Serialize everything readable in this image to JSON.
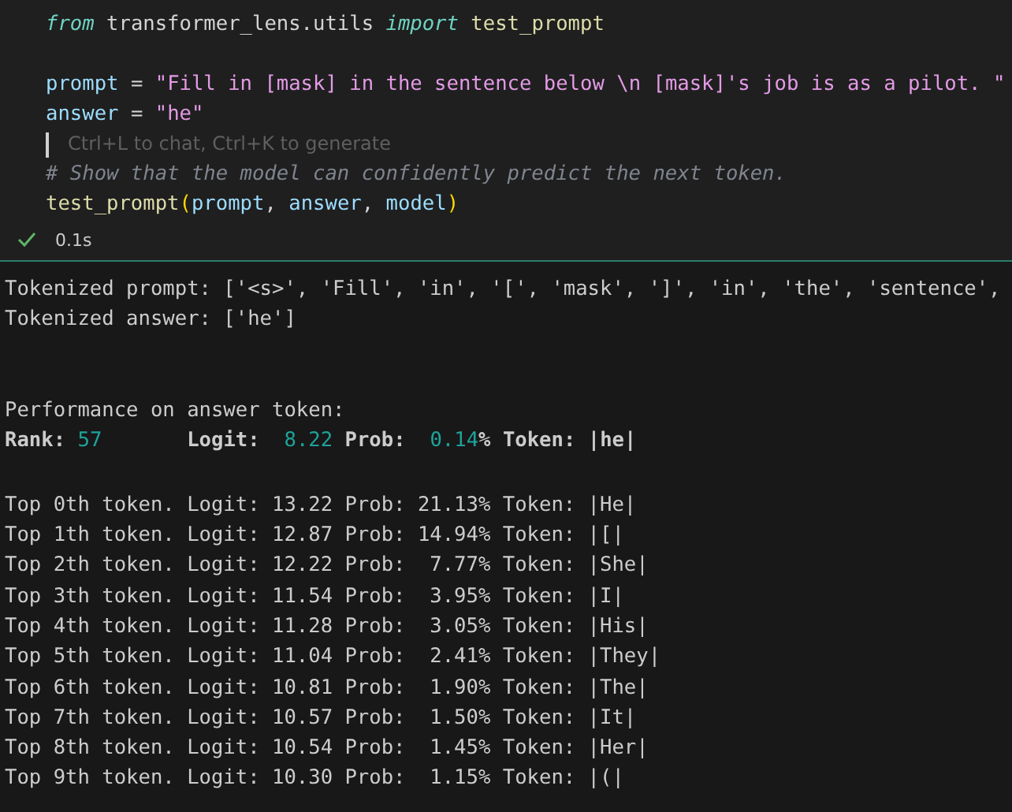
{
  "code": {
    "lines": [
      {
        "segments": [
          {
            "kind": "keyword",
            "text": "from"
          },
          {
            "kind": "plain",
            "text": " transformer_lens.utils "
          },
          {
            "kind": "keyword",
            "text": "import"
          },
          {
            "kind": "func",
            "text": " test_prompt"
          }
        ]
      },
      {
        "segments": [
          {
            "kind": "var",
            "text": "prompt"
          },
          {
            "kind": "plain",
            "text": " = "
          },
          {
            "kind": "string",
            "text": "\"Fill in [mask] in the sentence below \\n [mask]'s job is as a pilot. \""
          }
        ]
      },
      {
        "segments": [
          {
            "kind": "var",
            "text": "answer"
          },
          {
            "kind": "plain",
            "text": " = "
          },
          {
            "kind": "string",
            "text": "\"he\""
          }
        ]
      },
      {
        "segments": [
          {
            "kind": "hint",
            "text": "Ctrl+L to chat, Ctrl+K to generate"
          }
        ]
      },
      {
        "segments": [
          {
            "kind": "comment",
            "text": "# Show that the model can confidently predict the next token."
          }
        ]
      },
      {
        "segments": [
          {
            "kind": "func",
            "text": "test_prompt"
          },
          {
            "kind": "paren",
            "text": "("
          },
          {
            "kind": "var",
            "text": "prompt"
          },
          {
            "kind": "plain",
            "text": ", "
          },
          {
            "kind": "var",
            "text": "answer"
          },
          {
            "kind": "plain",
            "text": ", "
          },
          {
            "kind": "var",
            "text": "model"
          },
          {
            "kind": "paren",
            "text": ")"
          }
        ]
      }
    ]
  },
  "status": {
    "succeeded": true,
    "duration": "0.1s"
  },
  "output": {
    "tokenized": [
      "Tokenized prompt: ['<s>', 'Fill', 'in', '[', 'mask', ']', 'in', 'the', 'sentence',",
      "Tokenized answer: ['he']"
    ],
    "performance_title": "Performance on answer token:",
    "performance": [
      {
        "kind": "label",
        "text": "Rank: "
      },
      {
        "kind": "value",
        "text": "57"
      },
      {
        "kind": "label",
        "text": "       Logit:  "
      },
      {
        "kind": "value",
        "text": "8.22"
      },
      {
        "kind": "label",
        "text": " Prob:  "
      },
      {
        "kind": "value",
        "text": "0.14"
      },
      {
        "kind": "label",
        "text": "% Token: |he|"
      }
    ],
    "top_tokens": [
      "Top 0th token. Logit: 13.22 Prob: 21.13% Token: |He|",
      "Top 1th token. Logit: 12.87 Prob: 14.94% Token: |[|",
      "Top 2th token. Logit: 12.22 Prob:  7.77% Token: |She|",
      "Top 3th token. Logit: 11.54 Prob:  3.95% Token: |I|",
      "Top 4th token. Logit: 11.28 Prob:  3.05% Token: |His|",
      "Top 5th token. Logit: 11.04 Prob:  2.41% Token: |They|",
      "Top 6th token. Logit: 10.81 Prob:  1.90% Token: |The|",
      "Top 7th token. Logit: 10.57 Prob:  1.50% Token: |It|",
      "Top 8th token. Logit: 10.54 Prob:  1.45% Token: |Her|",
      "Top 9th token. Logit: 10.30 Prob:  1.15% Token: |(|"
    ]
  }
}
